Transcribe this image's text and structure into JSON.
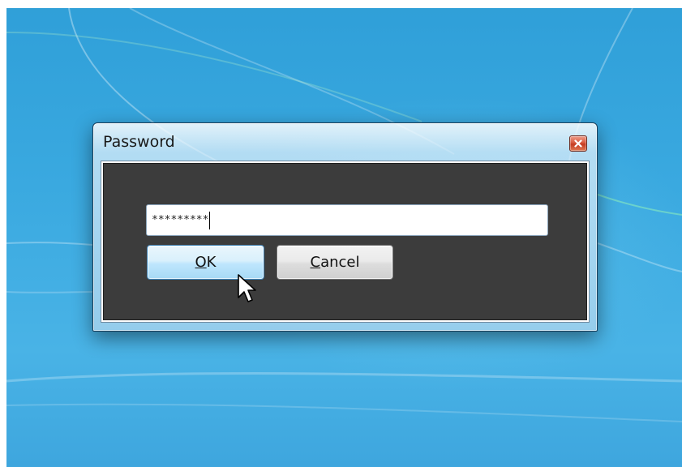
{
  "window": {
    "title": "Password",
    "close_icon": "close-icon"
  },
  "password_field": {
    "value": "*********"
  },
  "buttons": {
    "ok": {
      "accel": "O",
      "rest": "K"
    },
    "cancel": {
      "accel": "C",
      "rest": "ancel"
    }
  },
  "colors": {
    "desktop": "#3aa9e0",
    "client_bg": "#3c3c3c",
    "ok_button": "#bee6fd",
    "close_button": "#c43b21"
  },
  "cursor": {
    "icon": "mouse-pointer-icon"
  }
}
